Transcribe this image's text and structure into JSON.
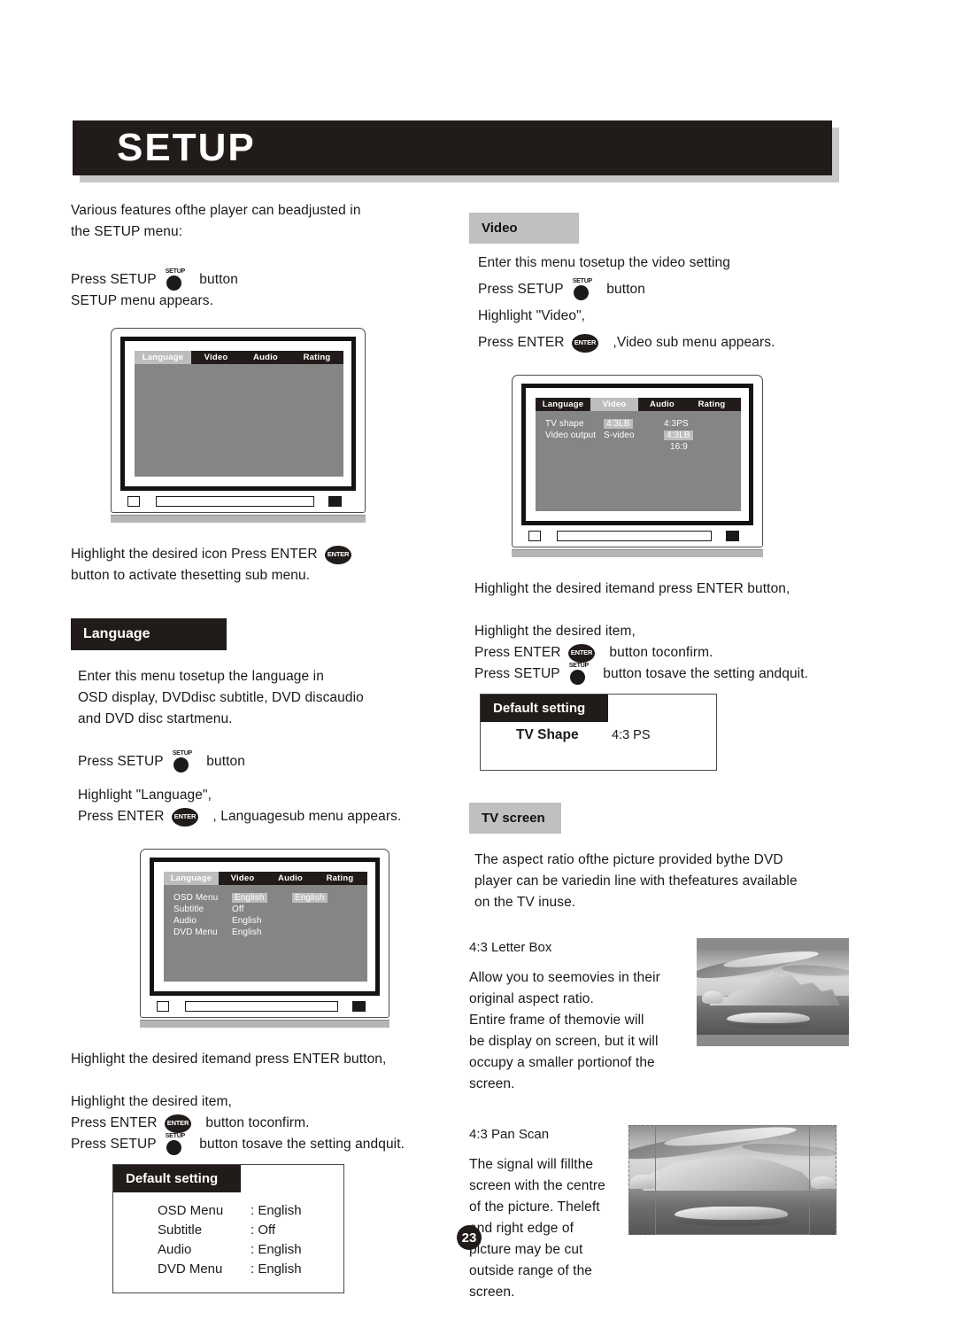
{
  "page": {
    "title": "SETUP",
    "number": "23"
  },
  "intro": {
    "line1": "Various features ofthe player can beadjusted in",
    "line2": "the SETUP menu:",
    "press_setup_pre": "Press SETUP",
    "press_setup_post": "button",
    "menu_appears": "SETUP menu appears."
  },
  "icons": {
    "setup_label": "SETUP",
    "enter_label": "ENTER"
  },
  "after_first_tv": {
    "line1a": "Highlight the desired icon",
    "line1b": "Press ENTER",
    "line2": "button to activate thesetting sub menu."
  },
  "setup_tv": {
    "tabs": [
      {
        "label": "Language",
        "selected": true
      },
      {
        "label": "Video",
        "selected": false
      },
      {
        "label": "Audio",
        "selected": false
      },
      {
        "label": "Rating",
        "selected": false
      }
    ],
    "rows": []
  },
  "language_section": {
    "header": "Language",
    "para": [
      "Enter this menu tosetup the language in",
      "OSD display, DVDdisc subtitle, DVD discaudio",
      "and DVD disc startmenu."
    ],
    "press_setup_pre": "Press SETUP",
    "press_setup_post": "button",
    "highlight": "Highlight \"Language\",",
    "press_enter_pre": "Press ENTER",
    "press_enter_post": ", Languagesub menu appears."
  },
  "language_tv": {
    "tabs": [
      {
        "label": "Language",
        "selected": true
      },
      {
        "label": "Video",
        "selected": false
      },
      {
        "label": "Audio",
        "selected": false
      },
      {
        "label": "Rating",
        "selected": false
      }
    ],
    "rows": [
      {
        "label": "OSD Menu",
        "value": "English",
        "value_hl": true,
        "option": "English",
        "option_hl": true
      },
      {
        "label": "Subtitle",
        "value": "Off",
        "value_hl": false,
        "option": "",
        "option_hl": false
      },
      {
        "label": "Audio",
        "value": "English",
        "value_hl": false,
        "option": "",
        "option_hl": false
      },
      {
        "label": "DVD Menu",
        "value": "English",
        "value_hl": false,
        "option": "",
        "option_hl": false
      }
    ]
  },
  "language_footer": {
    "line1": "Highlight the desired itemand press ENTER button,",
    "line2": "Highlight the desired item,",
    "press_enter_pre": "Press ENTER",
    "press_enter_post": "button toconfirm.",
    "press_setup_pre": "Press SETUP",
    "press_setup_post": "button tosave the setting andquit."
  },
  "language_default": {
    "title": "Default setting",
    "rows": [
      {
        "key": "OSD Menu",
        "value": ": English"
      },
      {
        "key": "Subtitle",
        "value": ": Off"
      },
      {
        "key": "Audio",
        "value": ": English"
      },
      {
        "key": "DVD Menu",
        "value": ": English"
      }
    ]
  },
  "video_section": {
    "header": "Video",
    "para": "Enter this menu tosetup the video setting",
    "press_setup_pre": "Press SETUP",
    "press_setup_post": "button",
    "highlight": "Highlight \"Video\",",
    "press_enter_pre": "Press ENTER",
    "press_enter_post": ",Video sub menu appears."
  },
  "video_tv": {
    "tabs": [
      {
        "label": "Language",
        "selected": false
      },
      {
        "label": "Video",
        "selected": true
      },
      {
        "label": "Audio",
        "selected": false
      },
      {
        "label": "Rating",
        "selected": false
      }
    ],
    "rows": [
      {
        "label": "TV shape",
        "value": "4:3LB",
        "value_hl": true,
        "option": "4:3PS",
        "option_hl": false
      },
      {
        "label": "Video output",
        "value": "S-video",
        "value_hl": false,
        "option": "4:3LB",
        "option_hl": true
      },
      {
        "label": "",
        "value": "",
        "value_hl": false,
        "option": "16:9",
        "option_hl": false
      }
    ]
  },
  "video_footer": {
    "line1": "Highlight the desired itemand press ENTER button,",
    "line2": "Highlight the desired item,",
    "press_enter_pre": "Press ENTER",
    "press_enter_post": "button toconfirm.",
    "press_setup_pre": "Press SETUP",
    "press_setup_post": "button tosave the setting andquit."
  },
  "video_default": {
    "title": "Default setting",
    "key": "TV Shape",
    "value": "4:3 PS"
  },
  "tv_screen_section": {
    "header": "TV screen",
    "para": [
      "The aspect ratio ofthe picture provided bythe DVD",
      "player can be variedin line with thefeatures available",
      "on the TV inuse."
    ]
  },
  "letterbox": {
    "caption": "4:3 Letter Box",
    "body": [
      "Allow you to seemovies in their",
      "original aspect ratio.",
      "Entire frame of themovie will",
      "be display on screen, but it will",
      "occupy a smaller portionof the",
      "screen."
    ]
  },
  "panscan": {
    "caption": "4:3 Pan Scan",
    "body": [
      "The signal will fillthe",
      "screen with the centre",
      "of the picture. Theleft",
      "and right edge of",
      "picture may be cut",
      "outside range of the",
      "screen."
    ]
  },
  "colors": {
    "banner_bg": "#211c19",
    "banner_shadow": "#c8c8c8",
    "header_gray": "#c0c0c0",
    "osd_bg": "#858585",
    "osd_tab_bg": "#211c19",
    "osd_highlight": "#bdbdbd",
    "text": "#1a1a1a"
  }
}
